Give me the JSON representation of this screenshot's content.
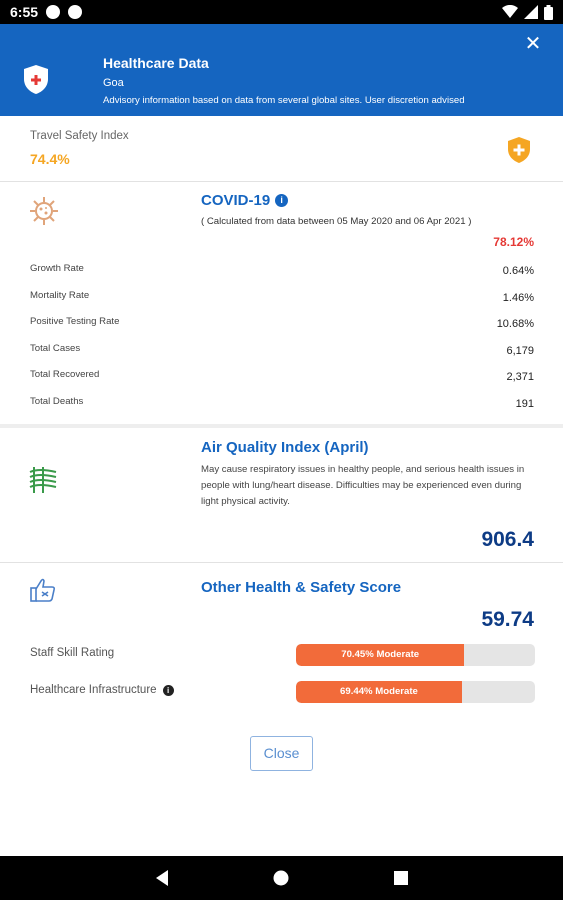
{
  "status_bar": {
    "time": "6:55"
  },
  "header": {
    "title": "Healthcare Data",
    "city": "Goa",
    "advisory": "Advisory information based on data from several global sites. User discretion advised",
    "close_icon": "close-icon",
    "accent": "#1565c0"
  },
  "travel_safety": {
    "label": "Travel Safety Index",
    "value": "74.4%",
    "color": "#f5a623"
  },
  "covid": {
    "title": "COVID-19",
    "calc_note": "( Calculated from data between 05 May 2020 and 06 Apr 2021 )",
    "percent": "78.12%",
    "rows": [
      {
        "label": "Growth Rate",
        "value": "0.64%"
      },
      {
        "label": "Mortality Rate",
        "value": "1.46%"
      },
      {
        "label": "Positive Testing Rate",
        "value": "10.68%"
      },
      {
        "label": "Total Cases",
        "value": "6,179"
      },
      {
        "label": "Total Recovered",
        "value": "2,371"
      },
      {
        "label": "Total Deaths",
        "value": "191"
      }
    ]
  },
  "aqi": {
    "title": "Air Quality Index (April)",
    "description": "May cause respiratory issues in healthy people, and serious health issues in people with lung/heart disease. Difficulties may be experienced even during light physical activity.",
    "value": "906.4"
  },
  "other": {
    "title": "Other Health & Safety Score",
    "score": "59.74",
    "bars": [
      {
        "label": "Staff Skill Rating",
        "text": "70.45% Moderate",
        "percent": 70.45,
        "info": false
      },
      {
        "label": "Healthcare Infrastructure",
        "text": "69.44% Moderate",
        "percent": 69.44,
        "info": true
      }
    ],
    "bar_color": "#f26b3a"
  },
  "close_button": "Close"
}
